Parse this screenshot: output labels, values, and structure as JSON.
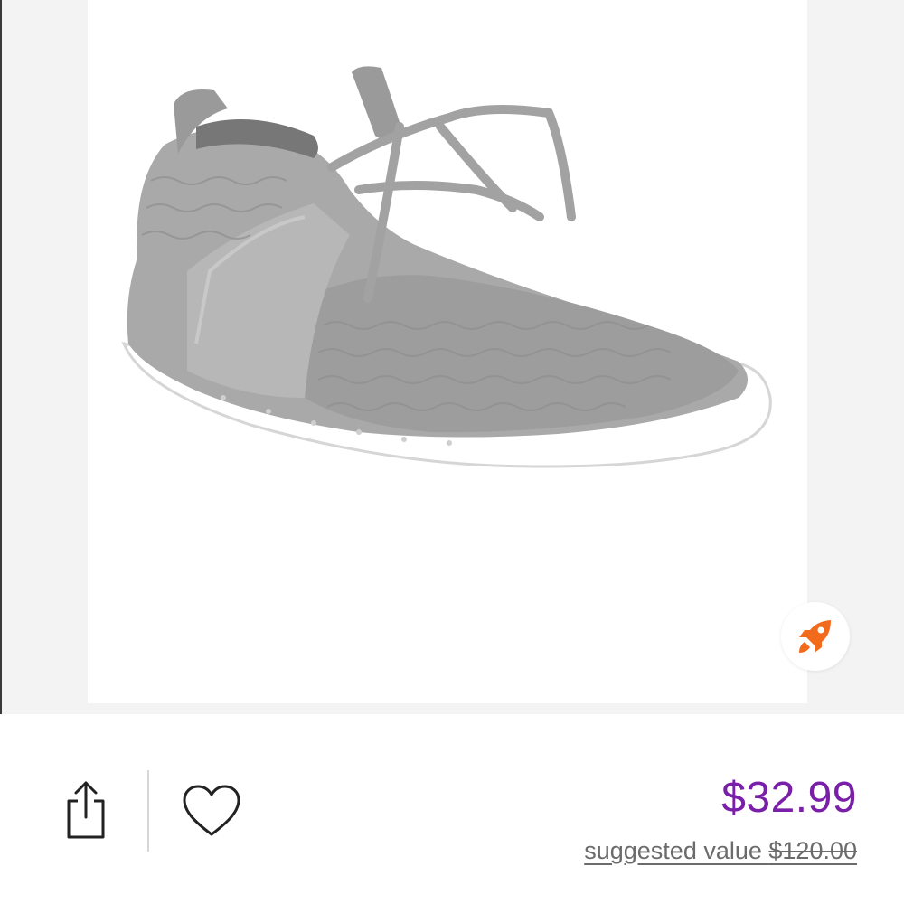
{
  "listing": {
    "price": "$32.99",
    "suggested_label": "suggested value ",
    "original_price": "$120.00"
  },
  "colors": {
    "price": "#7a1fa8",
    "boost_icon": "#f26a1b",
    "background": "#f3f3f3"
  },
  "icons": {
    "share": "share-icon",
    "like": "heart-icon",
    "boost": "rocket-icon"
  }
}
